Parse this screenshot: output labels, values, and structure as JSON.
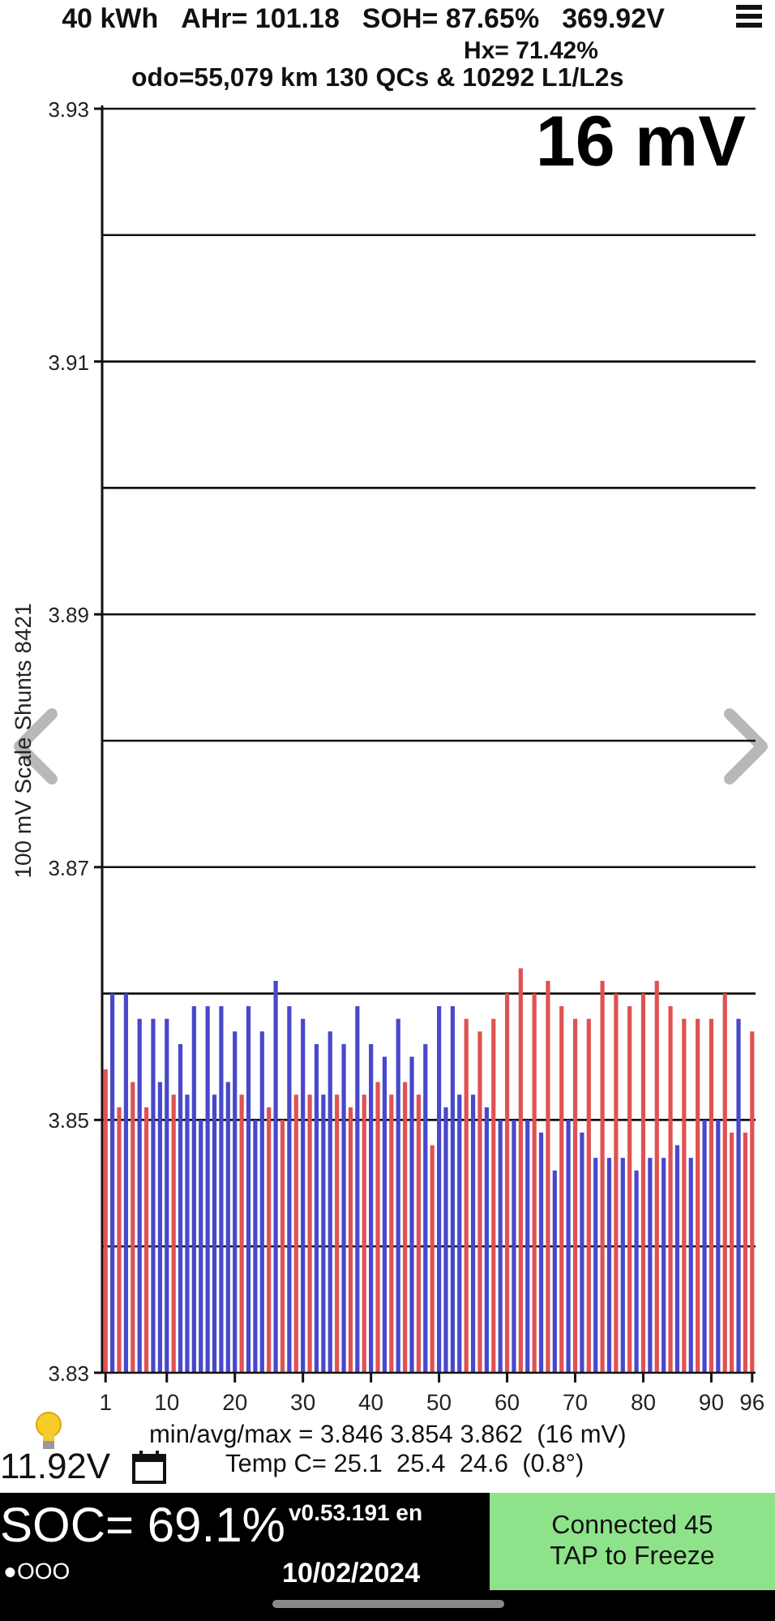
{
  "header": {
    "stats": [
      "40 kWh",
      "AHr= 101.18",
      "SOH= 87.65%",
      "369.92V"
    ],
    "hx": "Hx= 71.42%",
    "odometer": "odo=55,079 km 130 QCs & 10292 L1/L2s"
  },
  "cell_chart": {
    "chart_data": {
      "type": "bar",
      "ylabel": "100 mV Scale Shunts 8421",
      "x": [
        1,
        2,
        3,
        4,
        5,
        6,
        7,
        8,
        9,
        10,
        11,
        12,
        13,
        14,
        15,
        16,
        17,
        18,
        19,
        20,
        21,
        22,
        23,
        24,
        25,
        26,
        27,
        28,
        29,
        30,
        31,
        32,
        33,
        34,
        35,
        36,
        37,
        38,
        39,
        40,
        41,
        42,
        43,
        44,
        45,
        46,
        47,
        48,
        49,
        50,
        51,
        52,
        53,
        54,
        55,
        56,
        57,
        58,
        59,
        60,
        61,
        62,
        63,
        64,
        65,
        66,
        67,
        68,
        69,
        70,
        71,
        72,
        73,
        74,
        75,
        76,
        77,
        78,
        79,
        80,
        81,
        82,
        83,
        84,
        85,
        86,
        87,
        88,
        89,
        90,
        91,
        92,
        93,
        94,
        95,
        96
      ],
      "series": [
        {
          "color": "#4848cc",
          "values": [
            null,
            3.86,
            null,
            3.86,
            null,
            3.858,
            null,
            3.858,
            3.853,
            3.858,
            null,
            3.856,
            3.852,
            3.859,
            3.85,
            3.859,
            3.852,
            3.859,
            3.853,
            3.857,
            null,
            3.859,
            3.85,
            3.857,
            null,
            3.861,
            null,
            3.859,
            null,
            3.858,
            null,
            3.856,
            3.852,
            3.857,
            null,
            3.856,
            null,
            3.859,
            null,
            3.856,
            null,
            3.855,
            null,
            3.858,
            null,
            3.855,
            null,
            3.856,
            null,
            3.859,
            3.851,
            3.859,
            3.852,
            null,
            3.852,
            null,
            3.851,
            null,
            3.85,
            null,
            3.85,
            null,
            3.85,
            null,
            3.849,
            null,
            3.846,
            null,
            3.85,
            null,
            3.849,
            null,
            3.847,
            null,
            3.847,
            null,
            3.847,
            null,
            3.846,
            null,
            3.847,
            null,
            3.847,
            null,
            3.848,
            null,
            3.847,
            null,
            3.85,
            null,
            3.85,
            null,
            null,
            3.858,
            null,
            null
          ]
        },
        {
          "color": "#e05252",
          "values": [
            3.854,
            null,
            3.851,
            null,
            3.853,
            null,
            3.851,
            null,
            null,
            null,
            3.852,
            null,
            null,
            null,
            null,
            null,
            null,
            null,
            null,
            null,
            3.852,
            null,
            null,
            null,
            3.851,
            null,
            3.85,
            null,
            3.852,
            null,
            3.852,
            null,
            null,
            null,
            3.852,
            null,
            3.851,
            null,
            3.852,
            null,
            3.853,
            null,
            3.852,
            null,
            3.853,
            null,
            3.852,
            null,
            3.848,
            null,
            null,
            null,
            null,
            3.858,
            null,
            3.857,
            null,
            3.858,
            null,
            3.86,
            null,
            3.862,
            null,
            3.86,
            null,
            3.861,
            null,
            3.859,
            null,
            3.858,
            null,
            3.858,
            null,
            3.861,
            null,
            3.86,
            null,
            3.859,
            null,
            3.86,
            null,
            3.861,
            null,
            3.859,
            null,
            3.858,
            null,
            3.858,
            null,
            3.858,
            null,
            3.86,
            3.849,
            null,
            3.849,
            3.857
          ]
        }
      ],
      "ylim": [
        3.83,
        3.93
      ],
      "xlim": [
        0.5,
        96.5
      ],
      "grid": true,
      "yticks": [
        3.83,
        3.85,
        3.87,
        3.89,
        3.91,
        3.93
      ],
      "xticks": [
        1,
        10,
        20,
        30,
        40,
        50,
        60,
        70,
        80,
        90,
        96
      ],
      "annotations": [
        {
          "text": "16 mV"
        }
      ]
    }
  },
  "summary": {
    "voltage_range": "min/avg/max = 3.846 3.854 3.862  (16 mV)",
    "temperature": "Temp C= 25.1  25.4  24.6  (0.8°)",
    "battery_12v": "11.92V"
  },
  "status_bar": {
    "soc": "SOC= 69.1%",
    "dots": "●OOO",
    "version": "v0.53.191 en",
    "date": "10/02/2024",
    "connection": [
      "Connected 45",
      "TAP to Freeze"
    ]
  }
}
